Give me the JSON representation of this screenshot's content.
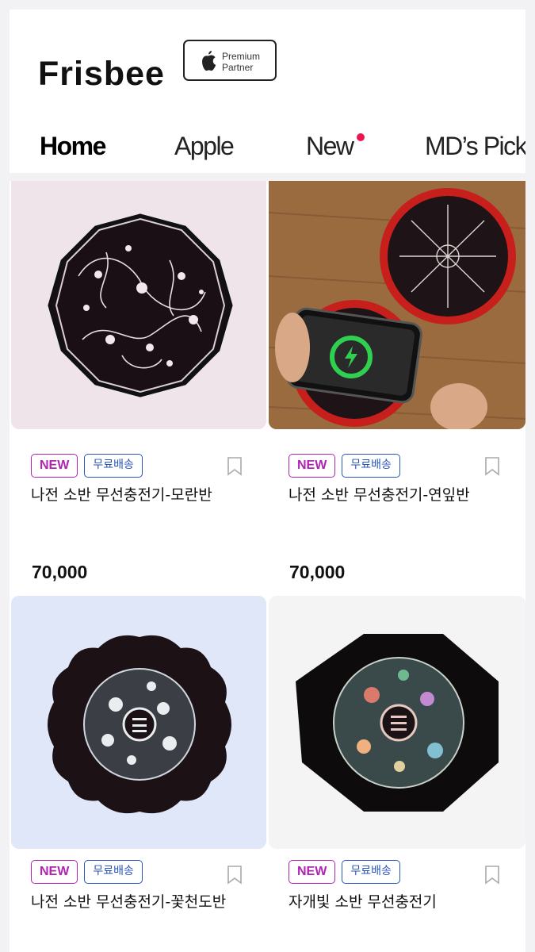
{
  "header": {
    "logo": "Frisbee",
    "partner_badge": {
      "icon": "apple-logo-icon",
      "line1": "Premium",
      "line2": "Partner"
    }
  },
  "nav": {
    "tabs": [
      {
        "label": "Home",
        "active": true
      },
      {
        "label": "Apple",
        "active": false
      },
      {
        "label": "New",
        "active": false,
        "indicator": "new-dot"
      },
      {
        "label": "MD’s Pick",
        "active": false
      }
    ],
    "indicator_color": "#e8174e"
  },
  "products": [
    {
      "name": "나전 소반 무선충전기-모란반",
      "price": "70,000",
      "badges": {
        "new": "NEW",
        "shipping": "무료배송"
      },
      "image": "dodecagon-black-lacquer-tray-floral-inlay",
      "bg": "#efe4ea"
    },
    {
      "name": "나전 소반 무선충전기-연잎반",
      "price": "70,000",
      "badges": {
        "new": "NEW",
        "shipping": "무료배송"
      },
      "image": "phone-charging-on-lotus-leaf-tray",
      "bg": "#9a6a3e"
    },
    {
      "name": "나전 소반 무선충전기-꽃천도반",
      "badges": {
        "new": "NEW",
        "shipping": "무료배송"
      },
      "image": "scalloped-tray-mother-of-pearl-peaches",
      "bg": "#dfe7f8"
    },
    {
      "name": "자개빛 소반 무선충전기",
      "badges": {
        "new": "NEW",
        "shipping": "무료배송"
      },
      "image": "octagon-tray-iridescent-mother-of-pearl",
      "bg": "#f4f4f5"
    }
  ],
  "colors": {
    "new_badge": "#b025b0",
    "shipping_badge": "#2a55b8"
  }
}
